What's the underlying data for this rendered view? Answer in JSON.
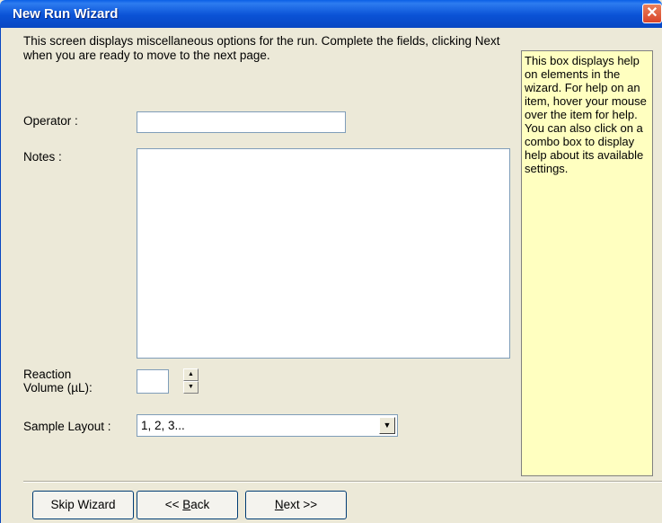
{
  "window": {
    "title": "New Run Wizard",
    "close_glyph": "✕"
  },
  "intro_text": "This screen displays miscellaneous options for the run. Complete the fields, clicking Next when you are ready to move to the next page.",
  "form": {
    "operator_label": "Operator :",
    "operator_value": "",
    "notes_label": "Notes :",
    "notes_value": "",
    "reaction_volume_label_1": "Reaction",
    "reaction_volume_label_2": "Volume (µL):",
    "reaction_volume_value": "",
    "sample_layout_label": "Sample Layout :",
    "sample_layout_value": "1, 2, 3..."
  },
  "help_text": "This box displays help on elements in the wizard. For help on an item, hover your mouse over the item for help. You can also click on a combo box to display help about its available settings.",
  "buttons": {
    "skip": "Skip Wizard",
    "back_prefix": "<< ",
    "back_key": "B",
    "back_rest": "ack",
    "next_key": "N",
    "next_rest": "ext >>"
  },
  "icons": {
    "close": "close-icon",
    "spin_up": "spin-up-icon",
    "spin_down": "spin-down-icon",
    "dropdown": "dropdown-arrow-icon"
  }
}
